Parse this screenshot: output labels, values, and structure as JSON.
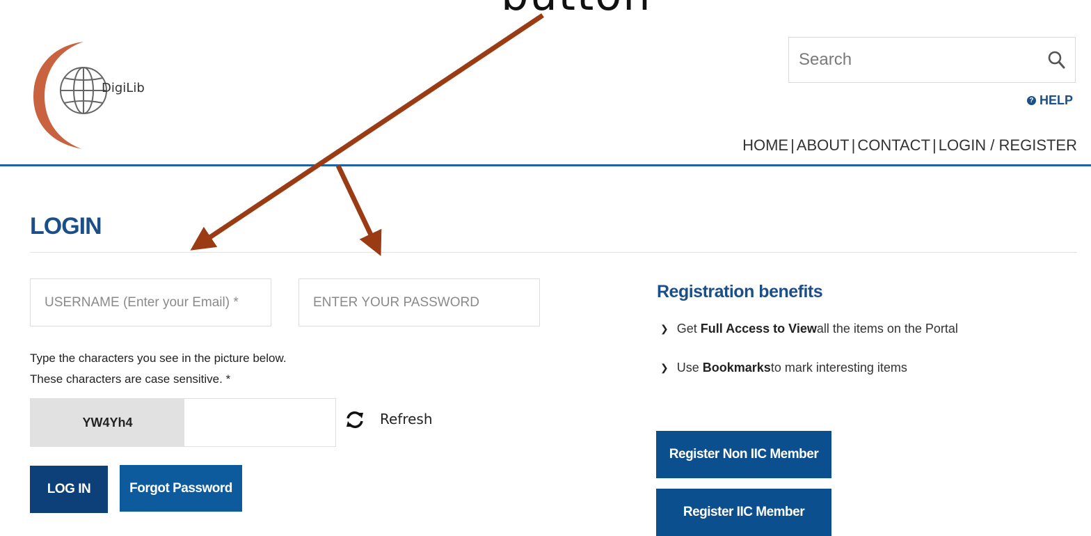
{
  "annotation": {
    "top_text": "button",
    "arrow_color": "#9a3b13"
  },
  "logo": {
    "text": "DigiLib",
    "accent_color": "#c8623f"
  },
  "search": {
    "placeholder": "Search"
  },
  "help": {
    "label": "HELP"
  },
  "nav": {
    "items": [
      "HOME",
      "ABOUT",
      "CONTACT",
      "LOGIN / REGISTER"
    ]
  },
  "login": {
    "title": "LOGIN",
    "username_placeholder": "USERNAME (Enter your Email) *",
    "password_placeholder": "ENTER YOUR PASSWORD",
    "captcha_instruction_line1": "Type the characters you see in the picture below.",
    "captcha_instruction_line2": "These characters are case sensitive. *",
    "captcha_code": "YW4Yh4",
    "refresh_label": "Refresh",
    "login_button": "LOG IN",
    "forgot_button": "Forgot Password"
  },
  "registration": {
    "title": "Registration benefits",
    "benefit1": {
      "prefix": "Get ",
      "bold": "Full Access to View",
      "suffix": " all the items on the Portal"
    },
    "benefit2": {
      "prefix": "Use ",
      "bold": "Bookmarks",
      "suffix": " to mark interesting items"
    },
    "non_member_button": "Register Non IIC Member",
    "member_button": "Register IIC Member"
  },
  "colors": {
    "brand_blue": "#1b4f8a",
    "button_blue": "#0d5a9c",
    "header_line": "#1d62a8"
  }
}
